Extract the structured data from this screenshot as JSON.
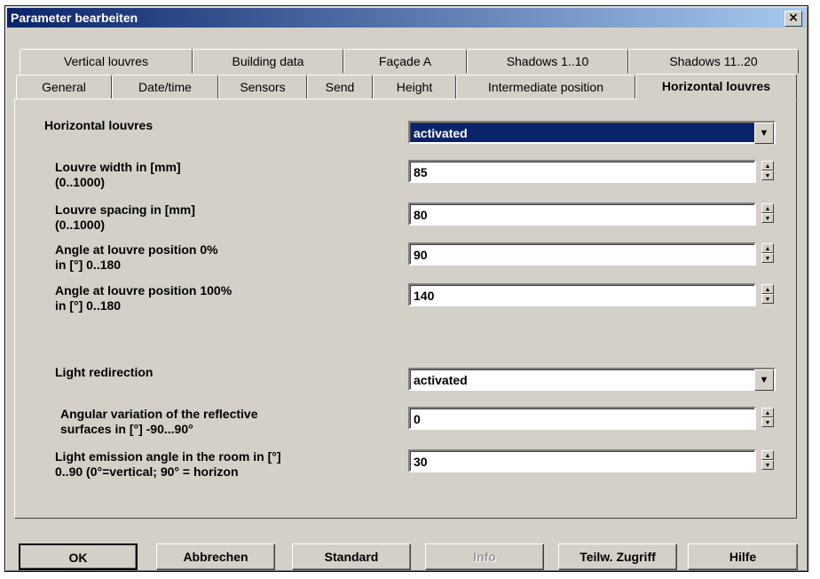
{
  "window": {
    "title": "Parameter bearbeiten",
    "close_label": "×"
  },
  "tabs_row1": [
    {
      "label": "Vertical louvres"
    },
    {
      "label": "Building data"
    },
    {
      "label": "Façade A"
    },
    {
      "label": "Shadows 1..10"
    },
    {
      "label": "Shadows 11..20"
    }
  ],
  "tabs_row2": [
    {
      "label": "General"
    },
    {
      "label": "Date/time"
    },
    {
      "label": "Sensors"
    },
    {
      "label": "Send"
    },
    {
      "label": "Height"
    },
    {
      "label": "Intermediate position"
    },
    {
      "label": "Horizontal louvres",
      "active": true
    }
  ],
  "params": {
    "horizontal_louvres": {
      "label": "Horizontal louvres",
      "value": "activated"
    },
    "louvre_width": {
      "label1": "Louvre width in [mm]",
      "label2": "(0..1000)",
      "value": "85"
    },
    "louvre_spacing": {
      "label1": "Louvre spacing in [mm]",
      "label2": "(0..1000)",
      "value": "80"
    },
    "angle_0": {
      "label1": "Angle at louvre position 0%",
      "label2": "in [°] 0..180",
      "value": "90"
    },
    "angle_100": {
      "label1": "Angle at louvre position 100%",
      "label2": "in [°] 0..180",
      "value": "140"
    },
    "light_redirection": {
      "label": "Light redirection",
      "value": "activated"
    },
    "angular_variation": {
      "label1": "Angular variation of the reflective",
      "label2": "surfaces in [°] -90...90°",
      "value": "0"
    },
    "emission_angle": {
      "label1": "Light emission angle in the room in [°]",
      "label2": "0..90 (0°=vertical; 90° = horizon",
      "value": "30"
    }
  },
  "buttons": {
    "ok": "OK",
    "cancel": "Abbrechen",
    "standard": "Standard",
    "info": "Info",
    "partial": "Teilw. Zugriff",
    "help": "Hilfe"
  }
}
